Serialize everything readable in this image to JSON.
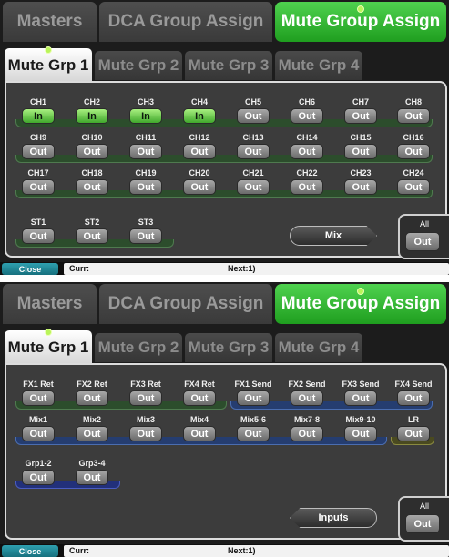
{
  "screens": [
    {
      "top_tabs": [
        {
          "label": "Masters",
          "active": false
        },
        {
          "label": "DCA Group Assign",
          "active": false
        },
        {
          "label": "Mute Group Assign",
          "active": true
        }
      ],
      "sub_tabs": [
        {
          "label": "Mute Grp 1",
          "active": true
        },
        {
          "label": "Mute Grp 2",
          "active": false
        },
        {
          "label": "Mute Grp 3",
          "active": false
        },
        {
          "label": "Mute Grp 4",
          "active": false
        }
      ],
      "channels": [
        {
          "label": "CH1",
          "state": "In"
        },
        {
          "label": "CH2",
          "state": "In"
        },
        {
          "label": "CH3",
          "state": "In"
        },
        {
          "label": "CH4",
          "state": "In"
        },
        {
          "label": "CH5",
          "state": "Out"
        },
        {
          "label": "CH6",
          "state": "Out"
        },
        {
          "label": "CH7",
          "state": "Out"
        },
        {
          "label": "CH8",
          "state": "Out"
        },
        {
          "label": "CH9",
          "state": "Out"
        },
        {
          "label": "CH10",
          "state": "Out"
        },
        {
          "label": "CH11",
          "state": "Out"
        },
        {
          "label": "CH12",
          "state": "Out"
        },
        {
          "label": "CH13",
          "state": "Out"
        },
        {
          "label": "CH14",
          "state": "Out"
        },
        {
          "label": "CH15",
          "state": "Out"
        },
        {
          "label": "CH16",
          "state": "Out"
        },
        {
          "label": "CH17",
          "state": "Out"
        },
        {
          "label": "CH18",
          "state": "Out"
        },
        {
          "label": "CH19",
          "state": "Out"
        },
        {
          "label": "CH20",
          "state": "Out"
        },
        {
          "label": "CH21",
          "state": "Out"
        },
        {
          "label": "CH22",
          "state": "Out"
        },
        {
          "label": "CH23",
          "state": "Out"
        },
        {
          "label": "CH24",
          "state": "Out"
        },
        {
          "label": "ST1",
          "state": "Out"
        },
        {
          "label": "ST2",
          "state": "Out"
        },
        {
          "label": "ST3",
          "state": "Out"
        }
      ],
      "nav_button": "Mix",
      "all": {
        "label": "All",
        "state": "Out"
      },
      "status": {
        "close": "Close",
        "curr": "Curr:",
        "next": "Next:1)"
      }
    },
    {
      "top_tabs": [
        {
          "label": "Masters",
          "active": false
        },
        {
          "label": "DCA Group Assign",
          "active": false
        },
        {
          "label": "Mute Group Assign",
          "active": true
        }
      ],
      "sub_tabs": [
        {
          "label": "Mute Grp 1",
          "active": true
        },
        {
          "label": "Mute Grp 2",
          "active": false
        },
        {
          "label": "Mute Grp 3",
          "active": false
        },
        {
          "label": "Mute Grp 4",
          "active": false
        }
      ],
      "channels": [
        {
          "label": "FX1 Ret",
          "state": "Out"
        },
        {
          "label": "FX2 Ret",
          "state": "Out"
        },
        {
          "label": "FX3 Ret",
          "state": "Out"
        },
        {
          "label": "FX4 Ret",
          "state": "Out"
        },
        {
          "label": "FX1 Send",
          "state": "Out"
        },
        {
          "label": "FX2 Send",
          "state": "Out"
        },
        {
          "label": "FX3 Send",
          "state": "Out"
        },
        {
          "label": "FX4 Send",
          "state": "Out"
        },
        {
          "label": "Mix1",
          "state": "Out"
        },
        {
          "label": "Mix2",
          "state": "Out"
        },
        {
          "label": "Mix3",
          "state": "Out"
        },
        {
          "label": "Mix4",
          "state": "Out"
        },
        {
          "label": "Mix5-6",
          "state": "Out"
        },
        {
          "label": "Mix7-8",
          "state": "Out"
        },
        {
          "label": "Mix9-10",
          "state": "Out"
        },
        {
          "label": "LR",
          "state": "Out"
        },
        {
          "label": "Grp1-2",
          "state": "Out"
        },
        {
          "label": "Grp3-4",
          "state": "Out"
        }
      ],
      "nav_button": "Inputs",
      "all": {
        "label": "All",
        "state": "Out"
      },
      "status": {
        "close": "Close",
        "curr": "Curr:",
        "next": "Next:1)"
      }
    }
  ],
  "colors": {
    "active_tab": "#2fb52f",
    "in_button": "#5ccf3c",
    "input_band": "#2c4d2c",
    "fx_band": "#253d70",
    "lr_band": "#4a4a20"
  }
}
